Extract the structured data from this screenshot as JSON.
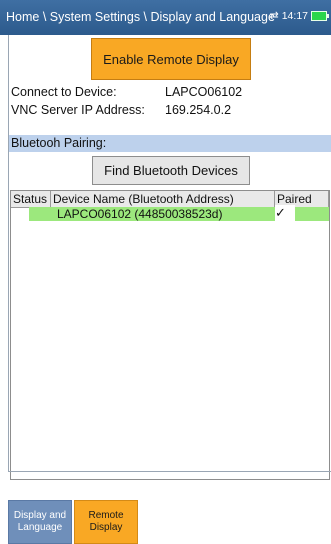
{
  "titlebar": {
    "breadcrumb": "Home \\ System Settings \\ Display and Language",
    "time": "14:17",
    "icons": {
      "connection": "swap-arrows-icon",
      "battery": "battery-icon"
    }
  },
  "remote": {
    "enable_button": "Enable Remote Display",
    "connect_label": "Connect to Device:",
    "connect_value": "LAPCO06102",
    "vnc_label": "VNC Server IP Address:",
    "vnc_value": "169.254.0.2"
  },
  "bluetooth": {
    "header": "Bluetooh Pairing:",
    "find_button": "Find Bluetooth Devices",
    "columns": [
      "Status",
      "Device Name (Bluetooth Address)",
      "Paired"
    ],
    "rows": [
      {
        "status": "",
        "name": "LAPCO06102 (44850038523d)",
        "paired": "✓"
      }
    ]
  },
  "tabs": {
    "display": "Display and Language",
    "remote": "Remote Display"
  },
  "colors": {
    "titlebar": "#2c5a8c",
    "accent": "#f9a824",
    "section": "#bdd1ec",
    "selected_row": "#9ce87d"
  }
}
